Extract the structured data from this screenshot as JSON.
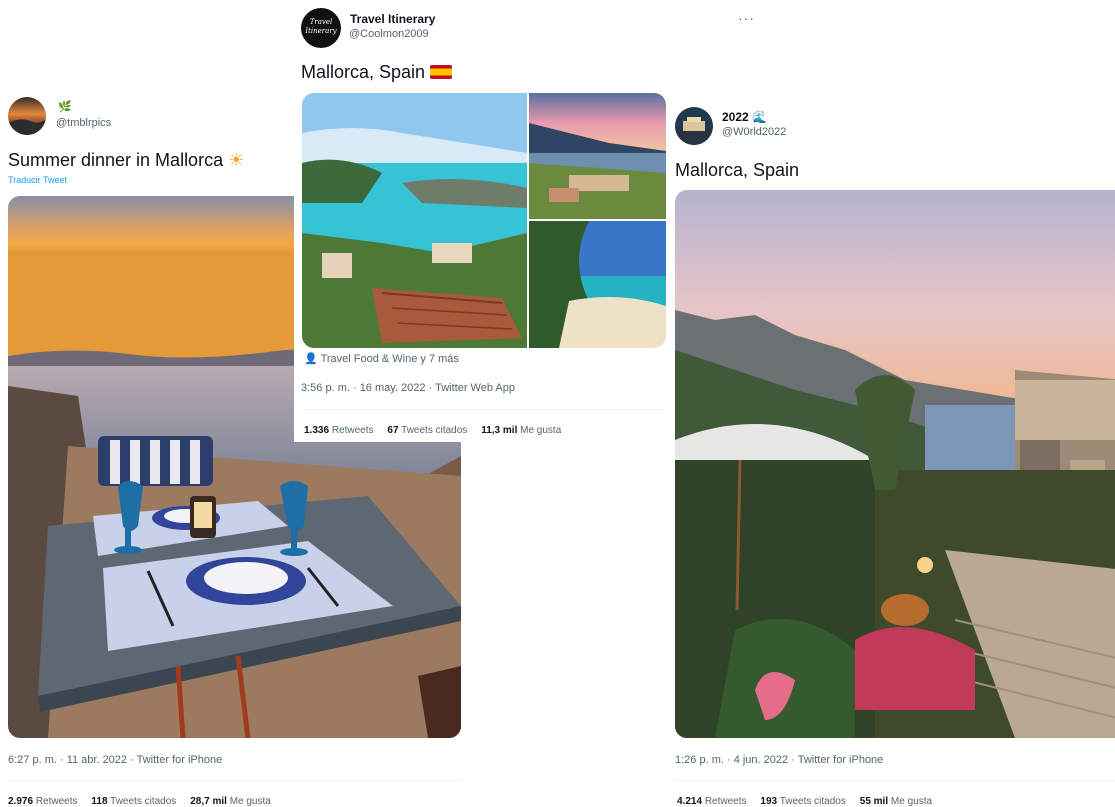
{
  "left": {
    "handle": "@tmblrpics",
    "text": "Summer dinner in Mallorca",
    "text_emoji": "☀️",
    "translate": "Traducir Tweet",
    "timestamp": "6:27 p. m. · 11 abr. 2022 · Twitter for iPhone",
    "retweets": "2.976",
    "retweets_label": "Retweets",
    "quotes": "118",
    "quotes_label": "Tweets citados",
    "likes": "28,7 mil",
    "likes_label": "Me gusta"
  },
  "middle": {
    "avatar_text_1": "Travel",
    "avatar_text_2": "Itinerary",
    "name": "Travel Itinerary",
    "handle": "@Coolmon2009",
    "text": "Mallorca, Spain",
    "tagged": "Travel Food & Wine y 7 más",
    "timestamp": "3:56 p. m. · 16 may. 2022 · Twitter Web App",
    "retweets": "1.336",
    "retweets_label": "Retweets",
    "quotes": "67",
    "quotes_label": "Tweets citados",
    "likes": "11,3 mil",
    "likes_label": "Me gusta",
    "more": "···"
  },
  "right": {
    "name": "2022",
    "handle": "@W0rld2022",
    "text": "Mallorca, Spain",
    "timestamp": "1:26 p. m. · 4 jun. 2022 · Twitter for iPhone",
    "retweets": "4.214",
    "retweets_label": "Retweets",
    "quotes": "193",
    "quotes_label": "Tweets citados",
    "likes": "55 mil",
    "likes_label": "Me gusta"
  },
  "icons": {
    "verified_like": "leaf-icon",
    "flag": "spain-flag-icon",
    "wave": "wave-icon",
    "person": "person-icon"
  }
}
